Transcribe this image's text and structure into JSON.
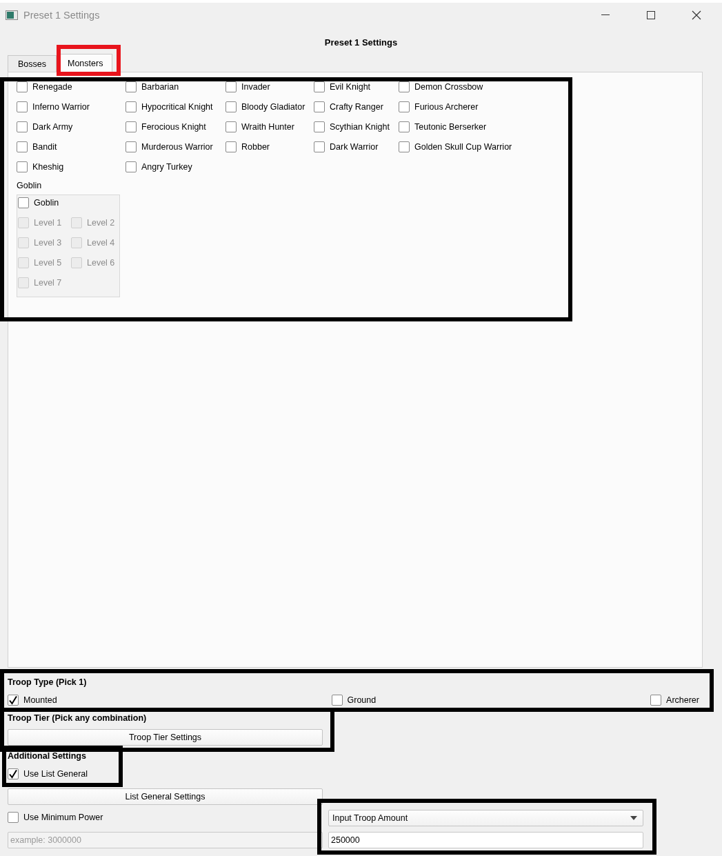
{
  "window": {
    "title": "Preset 1 Settings"
  },
  "header": "Preset 1 Settings",
  "tabs": [
    {
      "label": "Bosses",
      "selected": false
    },
    {
      "label": "Monsters",
      "selected": true
    }
  ],
  "monsters": {
    "rows": [
      [
        {
          "label": "Renegade",
          "checked": false
        },
        {
          "label": "Barbarian",
          "checked": false
        },
        {
          "label": "Invader",
          "checked": false
        },
        {
          "label": "Evil Knight",
          "checked": false
        },
        {
          "label": "Demon Crossbow",
          "checked": false
        }
      ],
      [
        {
          "label": "Inferno Warrior",
          "checked": false
        },
        {
          "label": "Hypocritical Knight",
          "checked": false
        },
        {
          "label": "Bloody Gladiator",
          "checked": false
        },
        {
          "label": "Crafty Ranger",
          "checked": false
        },
        {
          "label": "Furious Archerer",
          "checked": false
        }
      ],
      [
        {
          "label": "Dark Army",
          "checked": false
        },
        {
          "label": "Ferocious Knight",
          "checked": false
        },
        {
          "label": "Wraith Hunter",
          "checked": false
        },
        {
          "label": "Scythian Knight",
          "checked": false
        },
        {
          "label": "Teutonic Berserker",
          "checked": false
        }
      ],
      [
        {
          "label": "Bandit",
          "checked": false
        },
        {
          "label": "Murderous Warrior",
          "checked": false
        },
        {
          "label": "Robber",
          "checked": false
        },
        {
          "label": "Dark Warrior",
          "checked": false
        },
        {
          "label": "Golden Skull Cup Warrior",
          "checked": false
        }
      ],
      [
        {
          "label": "Kheshig",
          "checked": false
        },
        {
          "label": "Angry Turkey",
          "checked": false
        }
      ]
    ],
    "goblin": {
      "title": "Goblin",
      "master": {
        "label": "Goblin",
        "checked": false
      },
      "levels": [
        {
          "label": "Level 1",
          "checked": false,
          "disabled": true
        },
        {
          "label": "Level 2",
          "checked": false,
          "disabled": true
        },
        {
          "label": "Level 3",
          "checked": false,
          "disabled": true
        },
        {
          "label": "Level 4",
          "checked": false,
          "disabled": true
        },
        {
          "label": "Level 5",
          "checked": false,
          "disabled": true
        },
        {
          "label": "Level 6",
          "checked": false,
          "disabled": true
        },
        {
          "label": "Level 7",
          "checked": false,
          "disabled": true
        }
      ]
    }
  },
  "troop_type": {
    "title": "Troop Type (Pick 1)",
    "options": [
      {
        "label": "Mounted",
        "checked": true
      },
      {
        "label": "Ground",
        "checked": false
      },
      {
        "label": "Archerer",
        "checked": false
      }
    ]
  },
  "troop_tier": {
    "title": "Troop Tier (Pick any combination)",
    "button": "Troop Tier Settings"
  },
  "additional": {
    "title": "Additional Settings",
    "use_list_general": {
      "label": "Use List General",
      "checked": true
    },
    "button": "List General Settings",
    "use_minimum_power": {
      "label": "Use Minimum Power",
      "checked": false
    },
    "minimum_power": {
      "placeholder": "example: 3000000"
    }
  },
  "troop_amount": {
    "mode": "Input Troop Amount",
    "value": "250000"
  },
  "highlight_frames": [
    {
      "color": "#e8141c"
    },
    {
      "color": "#000000"
    },
    {
      "color": "#000000"
    },
    {
      "color": "#000000"
    },
    {
      "color": "#000000"
    },
    {
      "color": "#000000"
    }
  ]
}
